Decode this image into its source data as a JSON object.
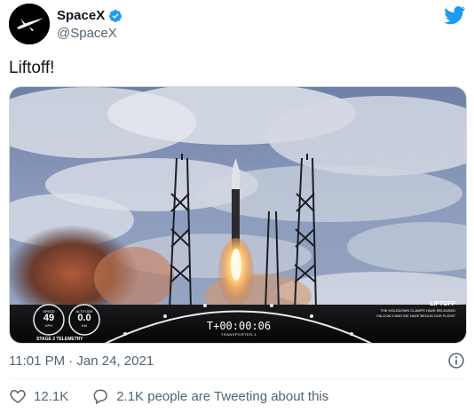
{
  "author": {
    "display_name": "SpaceX",
    "handle": "@SpaceX",
    "verified": true
  },
  "tweet": {
    "text": "Liftoff!"
  },
  "media": {
    "type": "video-frame",
    "overlay": {
      "speed_label": "SPEED",
      "speed_value": "49",
      "speed_unit": "KPH",
      "altitude_label": "ALTITUDE",
      "altitude_value": "0.0",
      "altitude_unit": "KM",
      "telemetry_label": "STAGE 2 TELEMETRY",
      "timer": "T+00:00:06",
      "mission": "TRANSPORTER-1",
      "headline": "LIFTOFF",
      "caption_line1": "THE HOLDDOWN CLAMPS HAVE RELEASED",
      "caption_line2": "FALCON 9 AND WE HAVE BEGUN OUR FLIGHT"
    }
  },
  "meta": {
    "timestamp": "11:01 PM · Jan 24, 2021"
  },
  "actions": {
    "likes": "12.1K",
    "conversation": "2.1K people are Tweeting about this"
  },
  "colors": {
    "brand_blue": "#1d9bf0",
    "secondary_text": "#536471"
  },
  "icons": {
    "verified": "verified-badge-icon",
    "bird": "twitter-bird-icon",
    "info": "info-icon",
    "heart": "heart-icon",
    "reply": "speech-bubble-icon"
  }
}
